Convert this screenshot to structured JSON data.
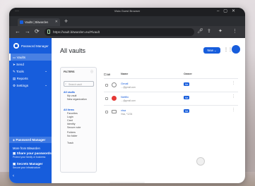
{
  "window": {
    "title": "Vista Guest Browser",
    "menu": "···",
    "controls": [
      "–",
      "▢",
      "✕"
    ]
  },
  "tab": {
    "title": "Vaults | Bitwarden",
    "close": "✕",
    "new_tab": "+"
  },
  "address": {
    "url": "https://vault.bitwarden.eu/#/vault",
    "back": "←",
    "forward": "→",
    "reload": "⟳",
    "toolbar_icons": [
      "mic-icon",
      "share-icon",
      "extensions-icon",
      "menu-icon"
    ]
  },
  "sidebar": {
    "product": "Password Manager",
    "items": [
      {
        "label": "Vaults",
        "active": true
      },
      {
        "label": "Send"
      },
      {
        "label": "Tools",
        "chevron": "⌄"
      },
      {
        "label": "Reports"
      },
      {
        "label": "Settings",
        "chevron": "⌄"
      }
    ],
    "switcher": {
      "current": "Password Manager",
      "more_from": "More from Bitwarden",
      "products": [
        {
          "name": "Share your passwords",
          "desc": "Protect your family or business"
        },
        {
          "name": "Secrets Manager",
          "desc": "Secure your infrastructure"
        }
      ]
    },
    "collapse": "‹"
  },
  "main": {
    "title": "All vaults",
    "new_button": "New ⌄",
    "grid_icon": "⋮⋮⋮"
  },
  "filters": {
    "title": "FILTERS",
    "info": "ⓘ",
    "search_placeholder": "Search vault",
    "groups": [
      {
        "label": "All vaults",
        "items": [
          "My vault",
          "New organization"
        ]
      },
      {
        "label": "All items",
        "items": [
          "Favorites",
          "Login",
          "Card",
          "Identity",
          "Secure note"
        ]
      }
    ],
    "folders": {
      "label": "Folders",
      "items": [
        "No folder"
      ]
    },
    "trash": "Trash"
  },
  "list": {
    "headers": {
      "all": "All",
      "name": "Name",
      "owner": "Owner"
    },
    "rows": [
      {
        "name": "Gmail",
        "subtitle": "…@gmail.com",
        "owner": "Me"
      },
      {
        "name": "Netflix",
        "subtitle": "…@gmail.com",
        "owner": "Me",
        "icon_color": "#e53935"
      },
      {
        "name": "visa",
        "subtitle": "Visa, *1234",
        "owner": "Me"
      }
    ],
    "row_menu": "⋮"
  },
  "colors": {
    "accent": "#175ddc",
    "sidebar": "#175ddc"
  }
}
